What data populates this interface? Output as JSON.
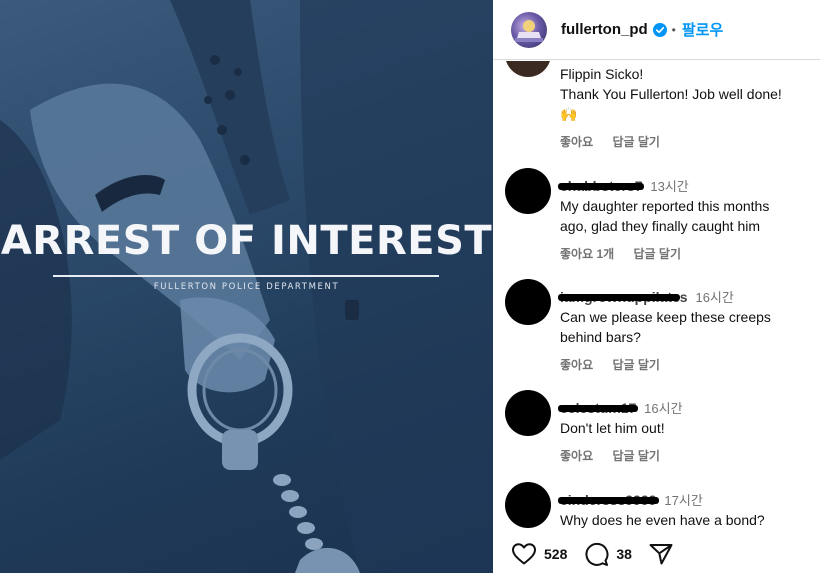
{
  "post": {
    "headline": "ARREST OF INTEREST",
    "subheadline": "FULLERTON POLICE DEPARTMENT"
  },
  "header": {
    "username": "fullerton_pd",
    "separator": "•",
    "follow_label": "팔로우"
  },
  "comments": [
    {
      "username": "",
      "time": "",
      "lines": [
        "Flippin Sicko!",
        "Thank You Fullerton! Job well done!",
        "🙌"
      ],
      "actions": [
        "좋아요",
        "답글 달기"
      ]
    },
    {
      "username": "chabbsters7",
      "time": "13시간",
      "lines": [
        "My daughter reported this months",
        "ago, glad they finally caught him"
      ],
      "actions": [
        "좋아요 1개",
        "답글 달기"
      ]
    },
    {
      "username": "iamgrownuppilates",
      "username_visible_suffix": "s",
      "time": "16시간",
      "lines": [
        "Can we please keep these creeps",
        "behind bars?"
      ],
      "actions": [
        "좋아요",
        "답글 달기"
      ]
    },
    {
      "username": "celestum17",
      "time": "16시간",
      "lines": [
        "Don't let him out!"
      ],
      "actions": [
        "좋아요",
        "답글 달기"
      ]
    },
    {
      "username": "cindersss9999",
      "time": "17시간",
      "lines": [
        "Why does he even have a bond?"
      ],
      "actions": []
    }
  ],
  "footer": {
    "likes": "528",
    "comments": "38",
    "icons": [
      "heart-icon",
      "comment-icon",
      "share-icon"
    ]
  },
  "colors": {
    "follow_blue": "#0095f6",
    "verified_blue": "#0095f6",
    "image_overlay": "#2c4a6b",
    "muted_text": "#737373"
  }
}
